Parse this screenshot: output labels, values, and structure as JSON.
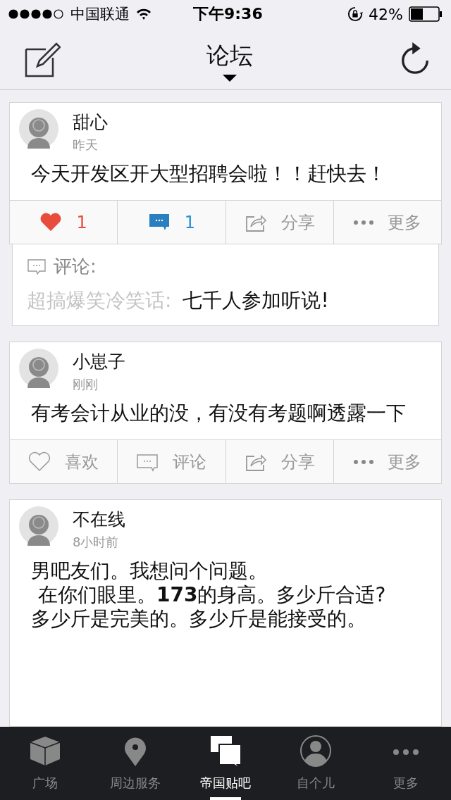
{
  "status_bar": {
    "carrier": "中国联通",
    "time": "下午9:36",
    "battery_percent": "42%"
  },
  "nav_bar": {
    "title": "论坛"
  },
  "posts": [
    {
      "author": "甜心",
      "time": "昨天",
      "body": "今天开发区开大型招聘会啦！！赶快去！",
      "actions": [
        {
          "kind": "like",
          "label": "1",
          "active": true
        },
        {
          "kind": "comment",
          "label": "1",
          "active": true
        },
        {
          "kind": "share",
          "label": "分享",
          "active": false
        },
        {
          "kind": "more",
          "label": "更多",
          "active": false
        }
      ],
      "comments": {
        "header": "评论:",
        "items": [
          {
            "user": "超搞爆笑冷笑话:",
            "text": "七千人参加听说!"
          }
        ]
      }
    },
    {
      "author": "小崽子",
      "time": "刚刚",
      "body": "有考会计从业的没，有没有考题啊透露一下",
      "actions": [
        {
          "kind": "like",
          "label": "喜欢",
          "active": false
        },
        {
          "kind": "comment",
          "label": "评论",
          "active": false
        },
        {
          "kind": "share",
          "label": "分享",
          "active": false
        },
        {
          "kind": "more",
          "label": "更多",
          "active": false
        }
      ]
    },
    {
      "author": "不在线",
      "time": "8小时前",
      "body_lines": [
        "男吧友们。我想问个问题。",
        "在你们眼里。**173**的身高。多少斤合适?",
        "多少斤是完美的。多少斤是能接受的。"
      ]
    }
  ],
  "tab_bar": [
    {
      "kind": "cube",
      "label": "广场",
      "selected": false
    },
    {
      "kind": "pin",
      "label": "周边服务",
      "selected": false
    },
    {
      "kind": "chat",
      "label": "帝国贴吧",
      "selected": true
    },
    {
      "kind": "person",
      "label": "自个儿",
      "selected": false
    },
    {
      "kind": "dots",
      "label": "更多",
      "selected": false
    }
  ]
}
